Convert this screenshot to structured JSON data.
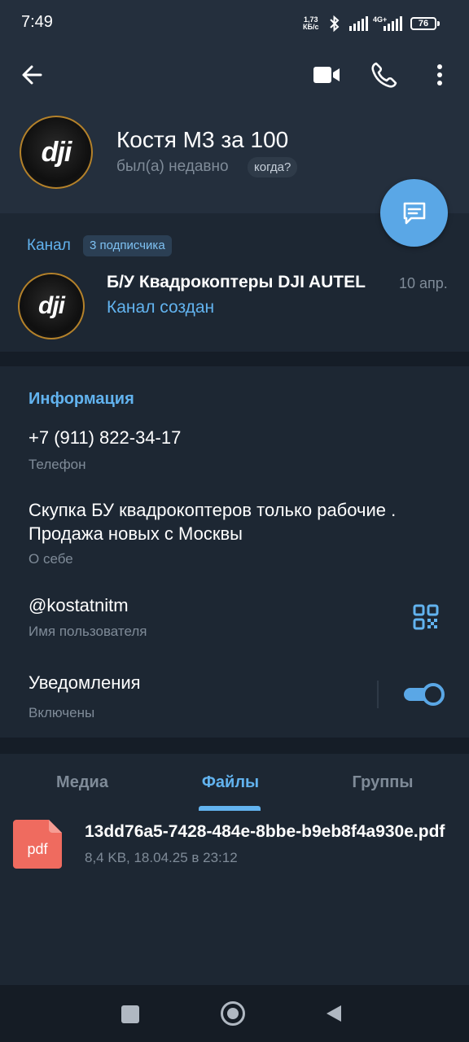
{
  "status_bar": {
    "time": "7:49",
    "net_speed_value": "1,73",
    "net_speed_unit": "КБ/с",
    "network_type": "4G+",
    "battery": "76"
  },
  "header": {
    "name": "Костя М3 за 100",
    "last_seen": "был(а) недавно",
    "when_badge": "когда?",
    "avatar_logo": "dji"
  },
  "channel": {
    "label": "Канал",
    "subscribers": "3 подписчика",
    "title": "Б/У Квадрокоптеры DJI AUTEL",
    "date": "10 апр.",
    "subtitle": "Канал создан",
    "avatar_logo": "dji"
  },
  "info": {
    "heading": "Информация",
    "phone": {
      "value": "+7 (911) 822-34-17",
      "label": "Телефон"
    },
    "bio": {
      "value": "Скупка БУ квадрокоптеров только рабочие . Продажа новых с Москвы",
      "label": "О себе"
    },
    "username": {
      "value": "@kostatnitm",
      "label": "Имя пользователя"
    },
    "notifications": {
      "value": "Уведомления",
      "label": "Включены",
      "enabled": true
    }
  },
  "tabs": [
    {
      "label": "Медиа",
      "active": false
    },
    {
      "label": "Файлы",
      "active": true
    },
    {
      "label": "Группы",
      "active": false
    }
  ],
  "files": [
    {
      "icon_text": "pdf",
      "name": "13dd76a5-7428-484e-8bbe-b9eb8f4a930e.pdf",
      "meta": "8,4 KB, 18.04.25 в 23:12"
    }
  ],
  "colors": {
    "accent": "#62b3ef",
    "fab": "#5aa7e6",
    "header_bg": "#242f3d",
    "body_bg": "#1d2733",
    "pdf_icon": "#ef6b5f"
  }
}
